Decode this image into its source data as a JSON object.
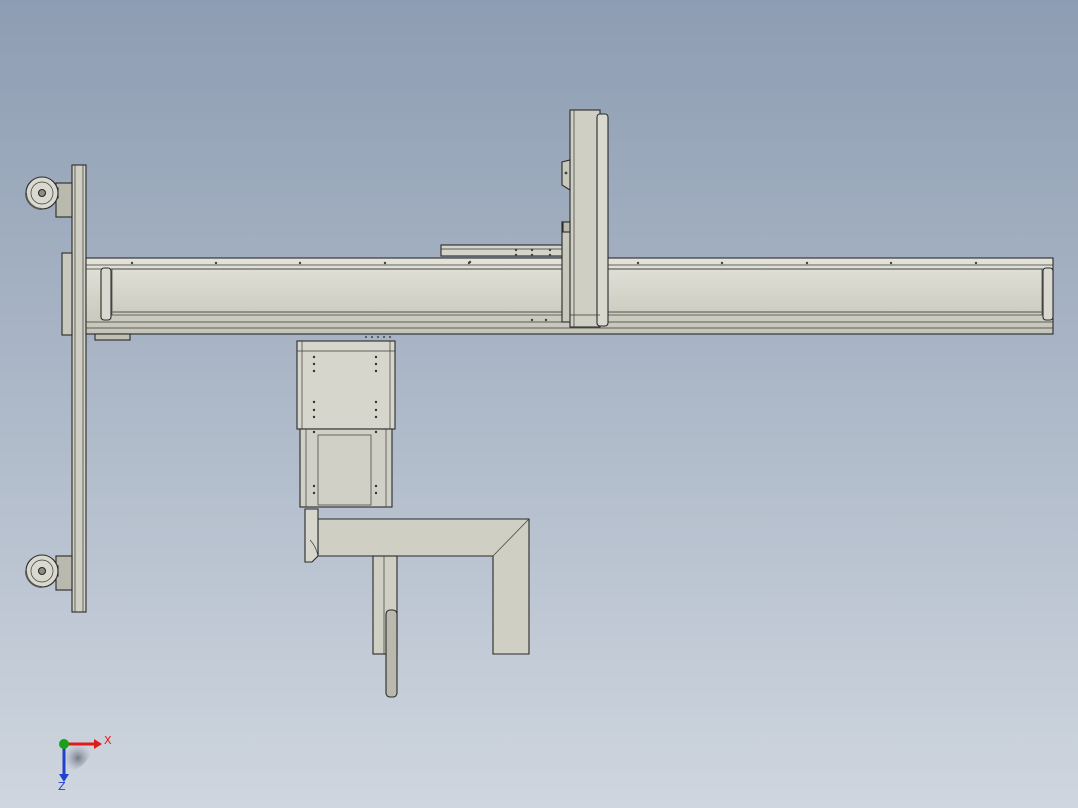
{
  "colors": {
    "background_top": "#8e9db3",
    "background_bottom": "#cfd6df",
    "part_fill": "#cfcfc4",
    "part_fill_dark": "#b9b9ad",
    "edge": "#2a2a2a",
    "axis_x": "#e01a1a",
    "axis_y": "#1aa01a",
    "axis_z": "#2040d0"
  },
  "triad": {
    "x_label": "X",
    "z_label": "Z"
  },
  "icons": [
    "caster-wheel-icon",
    "coordinate-triad-icon"
  ]
}
